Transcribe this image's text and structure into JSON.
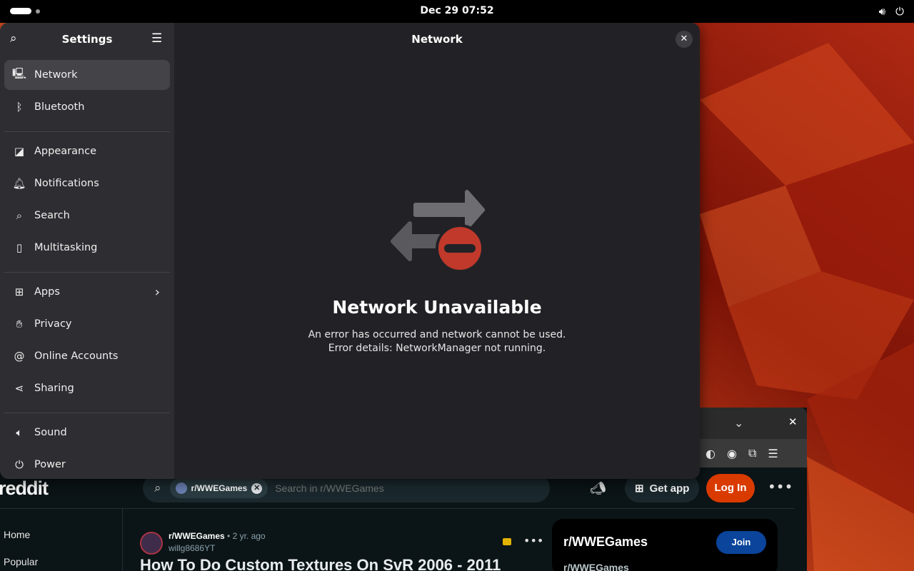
{
  "topbar": {
    "datetime": "Dec 29  07:52",
    "icons": [
      "volume-icon",
      "power-icon"
    ]
  },
  "settings": {
    "sidebar_title": "Settings",
    "content_title": "Network",
    "nav_groups": [
      [
        {
          "label": "Network",
          "icon": "network-icon",
          "active": true
        },
        {
          "label": "Bluetooth",
          "icon": "bluetooth-icon"
        }
      ],
      [
        {
          "label": "Appearance",
          "icon": "appearance-icon"
        },
        {
          "label": "Notifications",
          "icon": "bell-icon"
        },
        {
          "label": "Search",
          "icon": "search-icon"
        },
        {
          "label": "Multitasking",
          "icon": "multitasking-icon"
        }
      ],
      [
        {
          "label": "Apps",
          "icon": "apps-grid-icon",
          "chevron": true
        },
        {
          "label": "Privacy",
          "icon": "hand-icon"
        },
        {
          "label": "Online Accounts",
          "icon": "at-icon"
        },
        {
          "label": "Sharing",
          "icon": "share-icon"
        }
      ],
      [
        {
          "label": "Sound",
          "icon": "speaker-icon"
        },
        {
          "label": "Power",
          "icon": "plug-icon"
        }
      ]
    ],
    "error": {
      "title": "Network Unavailable",
      "line1": "An error has occurred and network cannot be used.",
      "line2": "Error details: NetworkManager not running."
    }
  },
  "browser": {
    "logo": "reddit",
    "search_chip": "r/WWEGames",
    "search_placeholder": "Search in r/WWEGames",
    "get_app": "Get app",
    "login": "Log In",
    "left_nav": [
      "Home",
      "Popular"
    ],
    "post": {
      "subreddit": "r/WWEGames",
      "age": "• 2 yr. ago",
      "user": "willg8686YT",
      "title": "How To Do Custom Textures On SvR 2006 - 2011"
    },
    "sidebar": {
      "title": "r/WWEGames",
      "join": "Join",
      "subtitle": "r/WWEGames"
    }
  },
  "colors": {
    "accent_login": "#d93a00",
    "join_button": "#0a449b",
    "error_red": "#c0392b"
  }
}
